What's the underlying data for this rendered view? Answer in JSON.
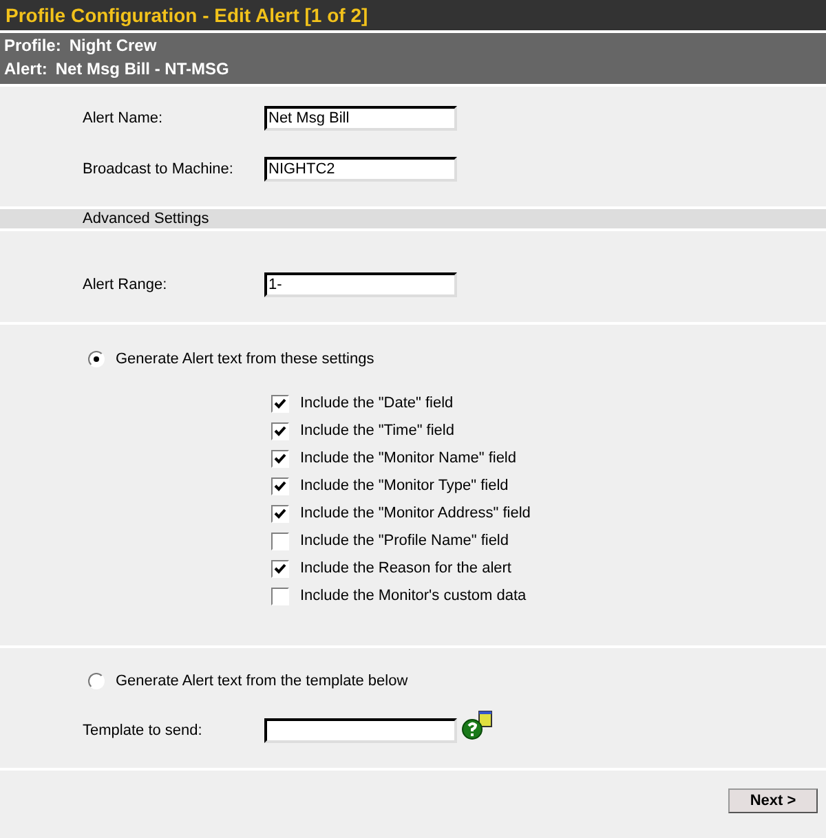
{
  "header": {
    "title": "Profile Configuration - Edit Alert [1 of 2]"
  },
  "info": [
    {
      "label": "Profile:",
      "value": "Night Crew"
    },
    {
      "label": "Alert:",
      "value": "Net Msg Bill - NT-MSG"
    }
  ],
  "basic_fields": [
    {
      "label": "Alert Name:",
      "value": "Net Msg Bill"
    },
    {
      "label": "Broadcast to Machine:",
      "value": "NIGHTC2"
    }
  ],
  "advanced_heading": "Advanced Settings",
  "range_field": {
    "label": "Alert Range:",
    "value": "1-"
  },
  "mode_settings": {
    "label": "Generate Alert text from these settings",
    "selected": true
  },
  "options": [
    {
      "label": "Include the \"Date\" field",
      "checked": true
    },
    {
      "label": "Include the \"Time\" field",
      "checked": true
    },
    {
      "label": "Include the \"Monitor Name\" field",
      "checked": true
    },
    {
      "label": "Include the \"Monitor Type\" field",
      "checked": true
    },
    {
      "label": "Include the \"Monitor Address\" field",
      "checked": true
    },
    {
      "label": "Include the \"Profile Name\" field",
      "checked": false
    },
    {
      "label": "Include the Reason for the alert",
      "checked": true
    },
    {
      "label": "Include the Monitor's custom data",
      "checked": false
    }
  ],
  "mode_template": {
    "label": "Generate Alert text from the template below",
    "selected": false
  },
  "template_field": {
    "label": "Template to send:"
  },
  "next_button": "Next >"
}
